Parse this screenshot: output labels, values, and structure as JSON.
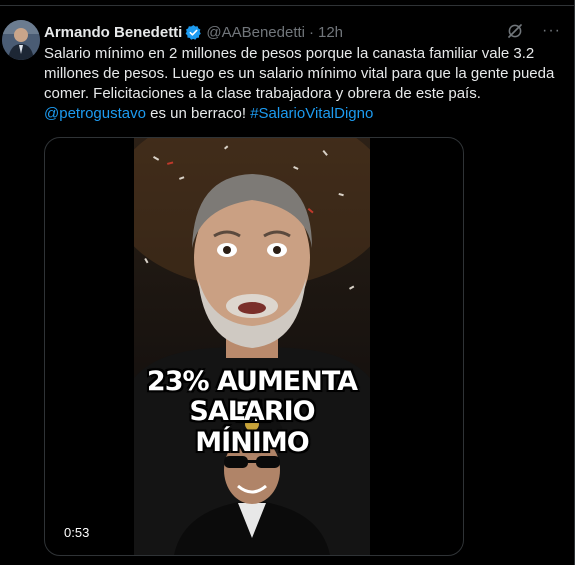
{
  "tweet": {
    "author_name": "Armando Benedetti",
    "handle": "@AABenedetti",
    "separator": "·",
    "time": "12h",
    "text_main": "Salario mínimo en 2 millones de pesos porque la canasta familiar vale 3.2 millones de pesos. Luego es un salario mínimo vital para que la gente pueda comer. Felicitaciones a la clase trabajadora y obrera de este país.",
    "mention": "@petrogustavo",
    "text_mid": " es un berraco! ",
    "hashtag": "#SalarioVitalDigno",
    "more_glyph": "···"
  },
  "media": {
    "caption_line1": "23% AUMENTA EL",
    "caption_line2": "SALARIO MÍNIMO",
    "duration": "0:53"
  },
  "colors": {
    "link": "#1d9bf0",
    "verified": "#1d9bf0",
    "secondary_text": "#71767b",
    "border": "#2f3336"
  }
}
